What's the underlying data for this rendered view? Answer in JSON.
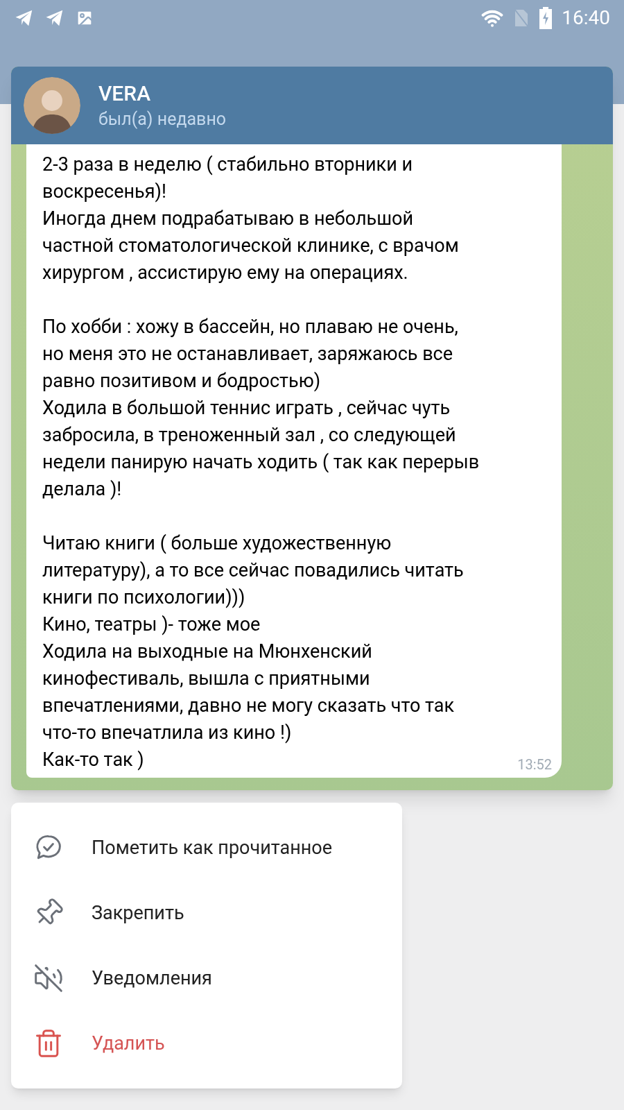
{
  "status_bar": {
    "time": "16:40"
  },
  "chat": {
    "name": "VERA",
    "status": "был(а) недавно",
    "message": {
      "paragraphs": [
        [
          "2-3  раза в неделю ( стабильно вторники и",
          "воскресенья)!",
          "Иногда днем подрабатываю в небольшой",
          "частной стоматологической клинике, с врачом",
          "хирургом , ассистирую ему на операциях."
        ],
        [
          "По хобби : хожу в бассейн, но плаваю не очень,",
          "но меня это не останавливает, заряжаюсь все",
          "равно позитивом и бодростью)",
          "Ходила в большой теннис играть , сейчас чуть",
          "забросила, в треноженный зал , со следующей",
          "недели панирую начать ходить ( так как перерыв",
          "делала )!"
        ],
        [
          "Читаю книги ( больше художественную",
          "литературу), а то все сейчас повадились читать",
          "книги по психологии)))",
          "Кино, театры )- тоже мое",
          "Ходила на выходные на Мюнхенский",
          "кинофестиваль, вышла с приятными",
          "впечатлениями, давно не могу сказать что так",
          "что-то впечатлила из кино !)",
          "Как-то так )"
        ]
      ],
      "time": "13:52"
    }
  },
  "menu": [
    {
      "kind": "read",
      "label": "Пометить как прочитанное",
      "destructive": false
    },
    {
      "kind": "pin",
      "label": "Закрепить",
      "destructive": false
    },
    {
      "kind": "mute",
      "label": "Уведомления",
      "destructive": false
    },
    {
      "kind": "delete",
      "label": "Удалить",
      "destructive": true
    }
  ]
}
